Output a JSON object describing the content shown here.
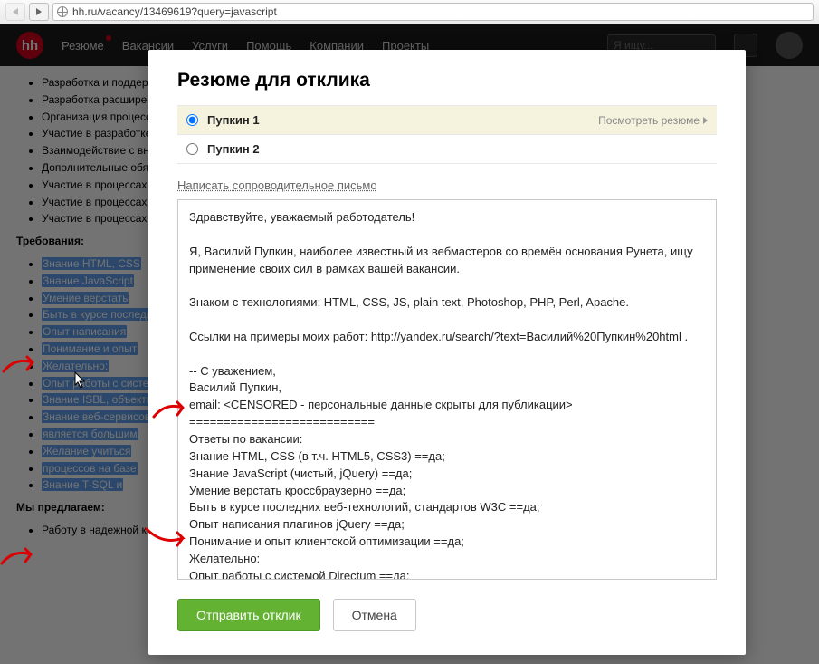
{
  "browser": {
    "url": "hh.ru/vacancy/13469619?query=javascript"
  },
  "header": {
    "logo": "hh",
    "nav": [
      "Резюме",
      "Вакансии",
      "Услуги",
      "Помощь",
      "Компании",
      "Проекты"
    ],
    "search_placeholder": "Я ищу..."
  },
  "vacancy": {
    "duties": [
      "Разработка и поддержка веб-приложений, интеграция с корпоративными системами",
      "Разработка расширений для Directum",
      "Организация процессов поддержки и развития Directum",
      "Участие в разработке и автоматизации бизнес процессов",
      "Взаимодействие с внутренними заказчиками, аналитиков, с коллегами",
      "Дополнительные обязанности",
      "Участие в процессах по выработке архитектурных решениям",
      "Участие в процессах по найму",
      "Участие в процессах по оценке пользователей на соответствие"
    ],
    "req_title": "Требования:",
    "reqs": [
      "Знание HTML, CSS",
      "Знание JavaScript",
      "Умение верстать",
      "Быть в курсе последних",
      "Опыт написания",
      "Понимание и опыт",
      "Желательно:",
      "Опыт работы с системой",
      "Знание ISBL, объектной",
      "Знание веб-сервисов",
      "является большим",
      "Желание учиться",
      "процессов на базе",
      "Знание T-SQL и"
    ],
    "offer_title": "Мы предлагаем:",
    "offers": [
      "Работу в надежной компании с известным брендом"
    ]
  },
  "modal": {
    "title": "Резюме для отклика",
    "resumes": [
      {
        "name": "Пупкин 1",
        "selected": true
      },
      {
        "name": "Пупкин 2",
        "selected": false
      }
    ],
    "view_label": "Посмотреть резюме",
    "cover_link": "Написать сопроводительное письмо",
    "cover_text": "Здравствуйте, уважаемый работодатель!\n\nЯ, Василий Пупкин, наиболее известный из вебмастеров со времён основания Рунета, ищу применение своих сил в рамках вашей вакансии.\n\nЗнаком с технологиями: HTML, CSS, JS, plain text, Photoshop, PHP, Perl, Apache.\n\nСсылки на примеры моих работ: http://yandex.ru/search/?text=Василий%20Пупкин%20html .\n\n-- С уважением,\nВасилий Пупкин,\nemail: <CENSORED - персональные данные скрыты для публикации>\n===========================\nОтветы по вакансии:\nЗнание HTML, CSS (в т.ч. HTML5, CSS3) ==да;\nЗнание JavaScript (чистый, jQuery) ==да;\nУмение верстать кроссбраузерно ==да;\nБыть в курсе последних веб-технологий, стандартов W3C ==да;\nОпыт написания плагинов jQuery ==да;\nПонимание и опыт клиентской оптимизации ==да;\nЖелательно:\nОпыт работы с системой Directum ==да;\nЗнание ISBL, объектной модели веб-доступа DIRECTUM ==да;\nЗнание веб-сервисов интеграции системы Directum – является большим плюсом ==да;\nЖелание учиться и развиваться в автоматизации бизнес процессов на базе DIRECTUM ==да;\nЗнание T-SQL и продуктов Microsoft SQL Server 2008 и выше ==да;",
    "submit": "Отправить отклик",
    "cancel": "Отмена"
  }
}
